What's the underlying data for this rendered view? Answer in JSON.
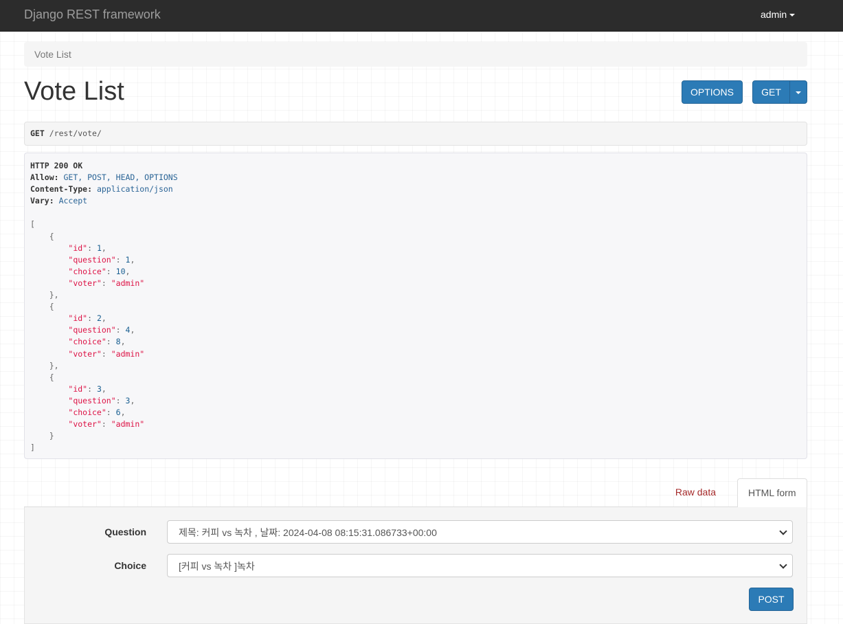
{
  "navbar": {
    "brand": "Django REST framework",
    "user": "admin"
  },
  "breadcrumb": {
    "current": "Vote List"
  },
  "page": {
    "title": "Vote List",
    "options_label": "OPTIONS",
    "get_label": "GET"
  },
  "request": {
    "method": "GET",
    "path": "/rest/vote/"
  },
  "response": {
    "status": "HTTP 200 OK",
    "headers": [
      {
        "name": "Allow",
        "value": "GET, POST, HEAD, OPTIONS"
      },
      {
        "name": "Content-Type",
        "value": "application/json"
      },
      {
        "name": "Vary",
        "value": "Accept"
      }
    ],
    "body": [
      {
        "id": 1,
        "question": 1,
        "choice": 10,
        "voter": "admin"
      },
      {
        "id": 2,
        "question": 4,
        "choice": 8,
        "voter": "admin"
      },
      {
        "id": 3,
        "question": 3,
        "choice": 6,
        "voter": "admin"
      }
    ]
  },
  "tabs": {
    "raw": "Raw data",
    "html": "HTML form"
  },
  "form": {
    "question_label": "Question",
    "question_value": "제목: 커피 vs 녹차 , 날짜: 2024-04-08 08:15:31.086733+00:00",
    "choice_label": "Choice",
    "choice_value": "[커피 vs 녹차 ]녹차",
    "post_label": "POST"
  },
  "colors": {
    "navbar_bg": "#2c2c2c",
    "button_blue": "#2c7bb6",
    "json_string": "#dd1144",
    "json_literal": "#195f91",
    "raw_tab": "#a52a2a"
  }
}
